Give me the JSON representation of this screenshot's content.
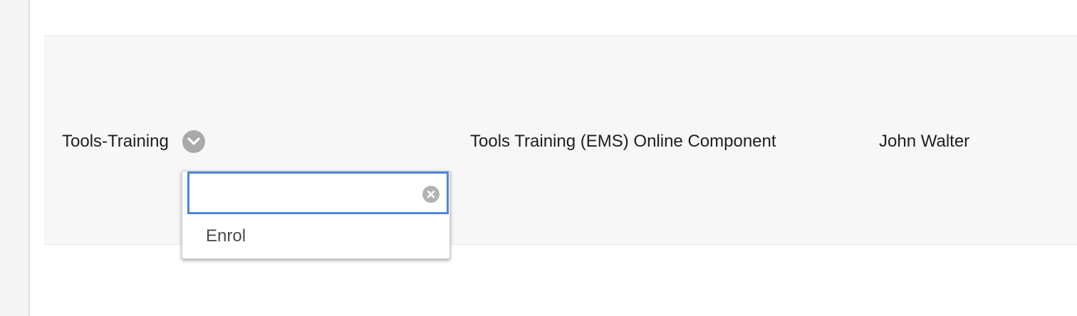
{
  "row": {
    "course_code": "Tools-Training",
    "course_title": "Tools Training (EMS) Online Component",
    "person": "John Walter"
  },
  "menu": {
    "search_value": "",
    "search_placeholder": "",
    "items": [
      {
        "label": "Enrol"
      }
    ]
  },
  "icons": {
    "row_menu": "chevron-down-icon",
    "clear": "clear-circle-icon"
  },
  "colors": {
    "focus_border": "#4a86d6",
    "row_background": "#f7f7f7",
    "icon_grey": "#a9a9a9"
  }
}
